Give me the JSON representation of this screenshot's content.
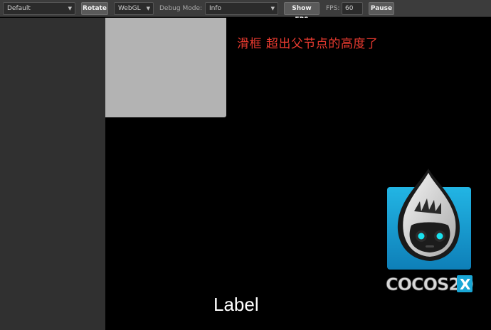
{
  "toolbar": {
    "resolution_select": "Default",
    "rotate_label": "Rotate",
    "renderer_select": "WebGL",
    "debug_mode_label": "Debug Mode:",
    "debug_mode_select": "Info",
    "show_fps_label": "Show FPS",
    "fps_label": "FPS:",
    "fps_value": "60",
    "pause_label": "Pause"
  },
  "canvas": {
    "red_text": "滑框 超出父节点的高度了",
    "label_text": "Label",
    "logo_text": "COCOS2DX",
    "logo_text_main": "COCOS2D",
    "logo_text_badge": "X"
  },
  "colors": {
    "toolbar_bg": "#3c3c3c",
    "left_panel_bg": "#303030",
    "canvas_bg": "#000000",
    "gray_box": "#b3b3b3",
    "red_text": "#e83a2f",
    "logo_blue": "#1aa7d6"
  }
}
